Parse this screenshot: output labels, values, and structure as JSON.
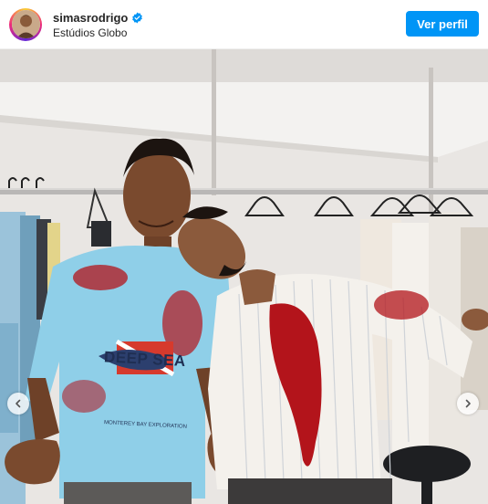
{
  "header": {
    "username": "simasrodrigo",
    "verified": true,
    "location": "Estúdios Globo",
    "follow_label": "Ver perfil"
  },
  "media": {
    "shirt_text": "DEEP SEA",
    "shirt_subtext": "MONTEREY BAY EXPLORATION"
  },
  "colors": {
    "follow_button": "#0095f6",
    "verified_badge": "#0095f6",
    "fake_blood": "#b3141b",
    "tshirt": "#8fcfe8"
  },
  "icons": {
    "verified": "verified-badge-icon",
    "prev": "chevron-left-icon",
    "next": "chevron-right-icon"
  }
}
